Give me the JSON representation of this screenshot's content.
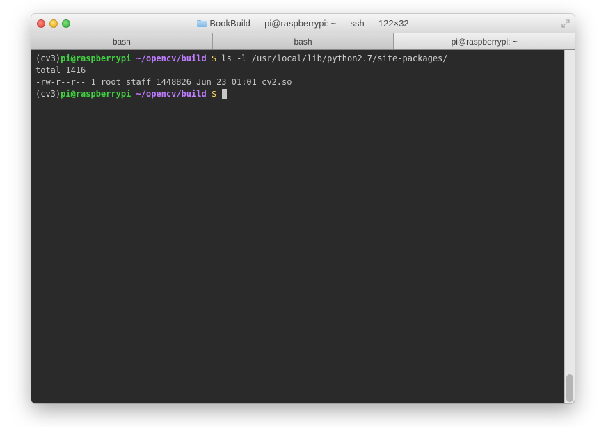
{
  "window": {
    "title": "BookBuild — pi@raspberrypi: ~ — ssh — 122×32"
  },
  "tabs": [
    {
      "label": "bash",
      "active": false
    },
    {
      "label": "bash",
      "active": false
    },
    {
      "label": "pi@raspberrypi: ~",
      "active": true
    }
  ],
  "terminal": {
    "prompt": {
      "venv": "(cv3)",
      "user": "pi",
      "at": "@",
      "host": "raspberrypi",
      "path": "~/opencv/build",
      "symbol": "$"
    },
    "lines": [
      {
        "type": "prompt",
        "command": "ls -l /usr/local/lib/python2.7/site-packages/"
      },
      {
        "type": "output",
        "text": "total 1416"
      },
      {
        "type": "output",
        "text": "-rw-r--r-- 1 root staff 1448826 Jun 23 01:01 cv2.so"
      },
      {
        "type": "prompt",
        "command": "",
        "cursor": true
      }
    ]
  }
}
